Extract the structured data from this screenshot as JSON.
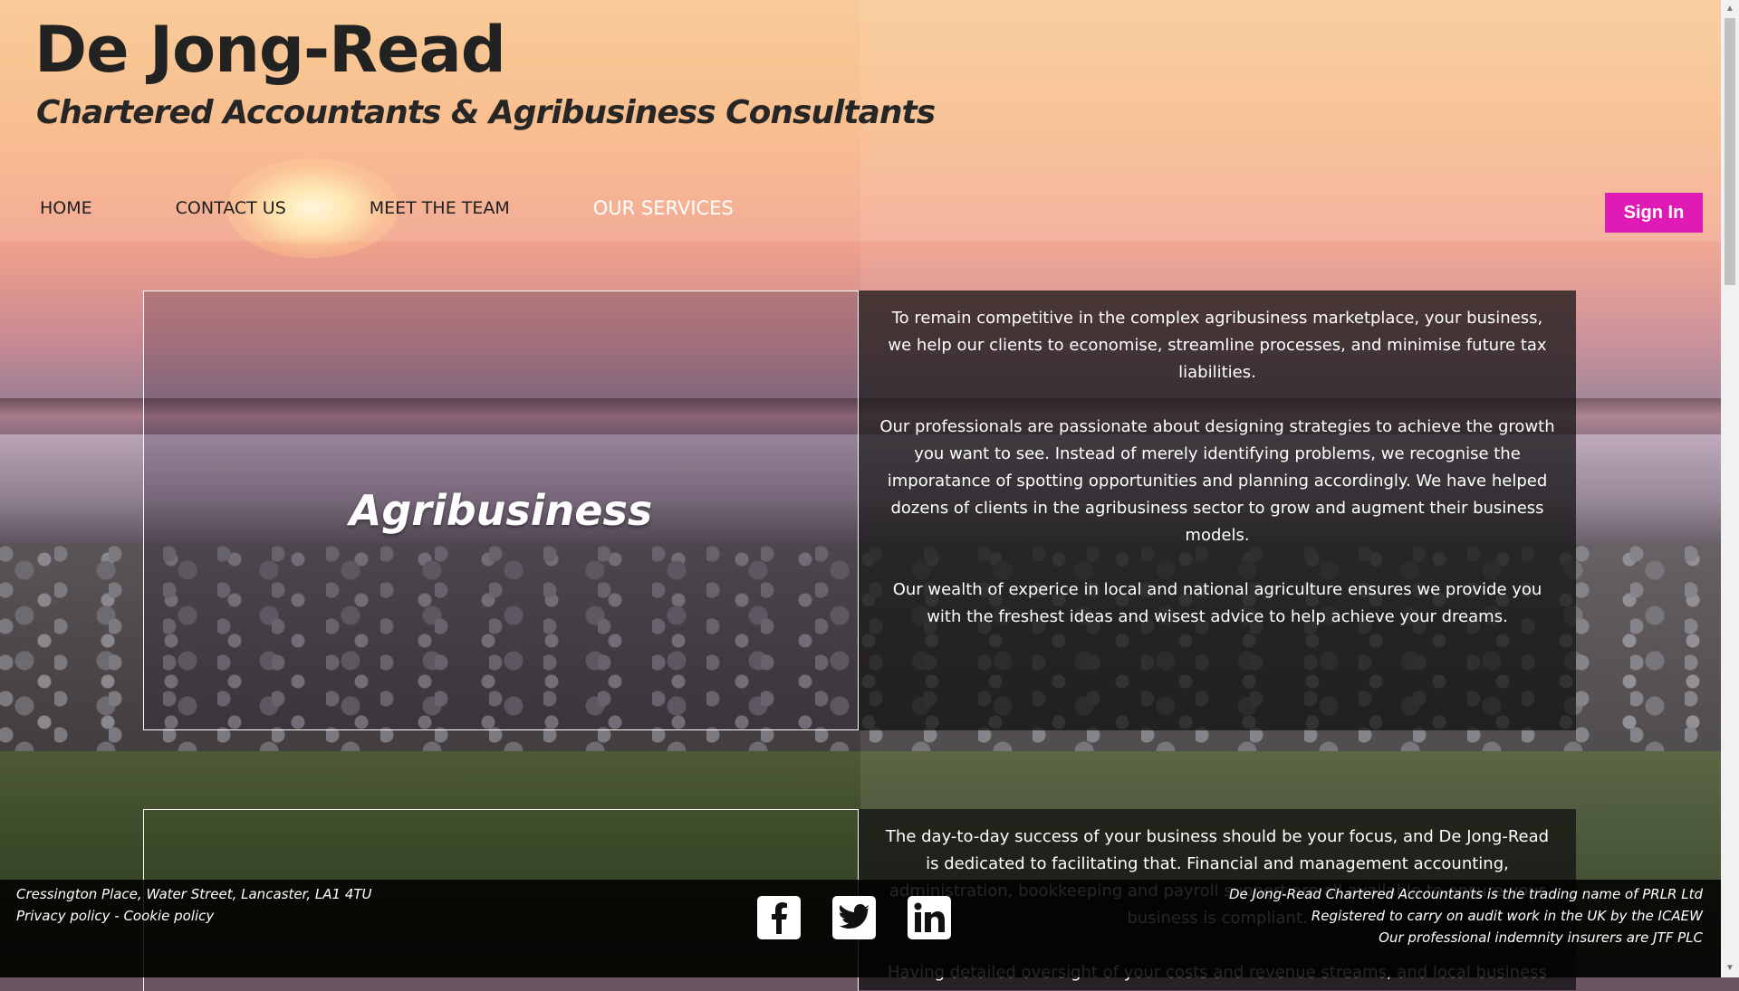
{
  "header": {
    "title": "De Jong-Read",
    "subtitle": "Chartered Accountants & Agribusiness Consultants"
  },
  "nav": {
    "items": [
      {
        "label": "HOME"
      },
      {
        "label": "CONTACT US"
      },
      {
        "label": "MEET THE TEAM"
      },
      {
        "label": "OUR SERVICES",
        "active": true
      }
    ]
  },
  "signin": {
    "label": "Sign In",
    "color": "#e01ab4"
  },
  "services": [
    {
      "title": "Agribusiness",
      "paragraphs": [
        "To remain competitive in the complex agribusiness marketplace, your business, we help our clients to economise, streamline processes, and minimise future tax liabilities.",
        "Our professionals are passionate about designing strategies to achieve the growth you want to see. Instead of merely identifying problems, we recognise the imporatance of spotting opportunities and planning accordingly. We have helped dozens of clients in the agribusiness sector to grow and augment their business models.",
        "Our wealth of experice in local and national agriculture ensures we provide you with the freshest ideas and wisest advice to help achieve your dreams."
      ]
    },
    {
      "title": "",
      "paragraphs": [
        "The day-to-day success of your business should be your focus, and De Jong-Read is dedicated to facilitating that. Financial and management accounting, administration, bookkeeping and payroll support are all available to ensure your business is compliant.",
        "Having detailed oversight of your costs and revenue streams, and local business trends"
      ]
    }
  ],
  "footer": {
    "address": "Cressington Place, Water Street, Lancaster, LA1 4TU",
    "privacy_link": "Privacy policy",
    "separator": " - ",
    "cookie_link": "Cookie policy",
    "legal": [
      "De Jong-Read Chartered Accountants is the trading name of PRLR Ltd",
      "Registered to carry on audit work in the UK by the ICAEW",
      "Our professional indemnity insurers are JTF PLC"
    ],
    "social_icons": [
      "facebook-icon",
      "twitter-icon",
      "linkedin-icon"
    ]
  }
}
